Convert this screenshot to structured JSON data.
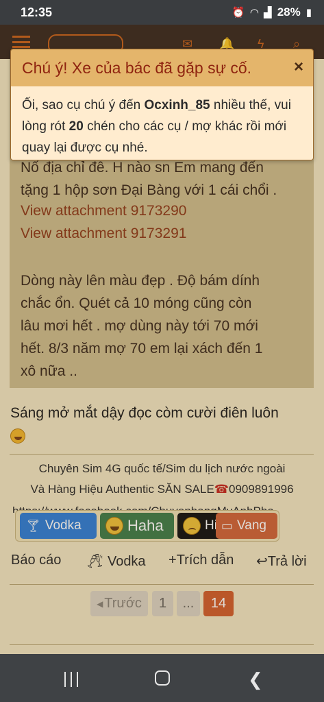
{
  "status_bar": {
    "time": "12:35",
    "battery": "28%"
  },
  "alert": {
    "title": "Chú ý! Xe của bác đã gặp sự cố.",
    "close": "×",
    "body_pre": "Ối, sao cụ chú ý đến ",
    "username": "Ocxinh_85",
    "body_mid": " nhiều thế, vui lòng rót ",
    "count": "20",
    "body_post": " chén cho các cụ / mợ khác rồi mới quay lại được cụ nhé."
  },
  "post": {
    "line1": "Nố địa chỉ đê. H nào sn Em mang đến",
    "line2": "tặng 1 hộp sơn Đại Bàng với 1 cái chổi .",
    "attachment1": "View attachment 9173290",
    "attachment2": "View attachment 9173291",
    "para2_line1": "Dòng này lên màu đẹp . Độ bám dính",
    "para2_line2": "chắc ổn. Quét cả 10 móng cũng còn",
    "para2_line3": "lâu mơi hết . mợ dùng này tới 70 mới",
    "para2_line4": "hết. 8/3 năm mợ 70 em lại xách đến 1",
    "para2_line5": "xô nữa .."
  },
  "reply": {
    "text": "Sáng mở mắt dậy đọc còm cười điên luôn"
  },
  "signature": {
    "line1": "Chuyên Sim 4G quốc tế/Sim du lịch nước ngoài",
    "line2": "Và Hàng Hiệu Authentic SĂN SALE",
    "phone": "0909891996",
    "line3": "https://www.facebook.com/ChuyenhangMyAnhPha"
  },
  "reactions": [
    {
      "label": "Vodka",
      "icon": "glass-icon"
    },
    {
      "label": "Haha",
      "icon": "laugh-emoji-icon"
    },
    {
      "label": "Hic",
      "icon": "sad-emoji-icon"
    },
    {
      "label": "Vang",
      "icon": "wine-glass-icon"
    }
  ],
  "actions": {
    "report": "Báo cáo",
    "vodka": "Vodka",
    "quote": "Trích dẫn",
    "reply": "Trả lời"
  },
  "pagination": {
    "prev": "Trước",
    "page1": "1",
    "dots": "...",
    "current": "14"
  },
  "colors": {
    "accent": "#d25f2c",
    "alert_header": "#e4b56b",
    "alert_body": "#ffeccf",
    "link": "#8f3a1a"
  }
}
